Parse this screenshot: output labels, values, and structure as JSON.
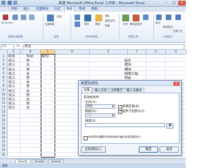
{
  "window": {
    "title": "新建 Microsoft Office Excel 工作表 - Microsoft Excel",
    "min": "–",
    "max": "□",
    "close": "×"
  },
  "ribbon_tabs": [
    "开始",
    "插入",
    "页面布局",
    "公式",
    "数据",
    "审阅",
    "视图"
  ],
  "ribbon_active_tab": "数据",
  "ribbon_groups": {
    "get_external": "获取外部数据",
    "connections": "连接",
    "sort_filter": "排序和筛选",
    "data_tools": "数据工具",
    "outline": "分级显示",
    "access": "自 Access",
    "refresh": "全部刷新",
    "sort": "排序",
    "filter": "筛选",
    "clear": "清除",
    "reapply": "重新应用",
    "advanced": "高级",
    "text_to_columns": "分列",
    "remove_dup": "删除重复项",
    "group": "组合",
    "ungroup": "取消组合",
    "subtotal": "分类汇总"
  },
  "formula_bar": {
    "name_box": "C1",
    "fx": "fx",
    "value": "职业"
  },
  "columns": [
    "A",
    "B",
    "C",
    "D",
    "E",
    "F",
    "G",
    "H"
  ],
  "rows": [
    "1",
    "2",
    "3",
    "4",
    "5",
    "6",
    "7",
    "8",
    "9",
    "10",
    "11",
    "12",
    "13",
    "14",
    "15",
    "16",
    "17",
    "18",
    "19",
    "20",
    "21",
    "22",
    "23",
    "24"
  ],
  "cells": {
    "header": [
      "姓名",
      "性别",
      "职业"
    ],
    "names": [
      "张三",
      "张三",
      "张三",
      "张三",
      "张三",
      "张三",
      "张三",
      "张三",
      "张三",
      "张三",
      "张三",
      "张三"
    ],
    "genders": [
      "男",
      "女",
      "男",
      "女",
      "男",
      "女",
      "男",
      "女",
      "男",
      "女",
      "男",
      "女"
    ],
    "occupations": [
      "医生",
      "老师",
      "律师",
      "网络工程",
      "农民",
      "编辑工作",
      "工人"
    ]
  },
  "sheet_tabs": [
    "Sheet1",
    "Sheet2",
    "Sheet3"
  ],
  "status": "就绪",
  "dialog": {
    "title": "数据有效性",
    "close": "×",
    "tabs": [
      "设置",
      "输入信息",
      "出错警告",
      "输入法模式"
    ],
    "active_tab": "设置",
    "criteria_label": "有效性条件",
    "allow_label": "允许(A):",
    "allow_value": "序列",
    "data_label": "数据(D):",
    "data_value": "介于",
    "ignore_blank": "忽略空值(B)",
    "dropdown": "提供下拉箭头(I)",
    "source_label": "来源(S):",
    "source_value": "",
    "apply_all": "对有同样设置的所有其他单元格应用这些更改(P)",
    "clear_all": "全部清除(C)",
    "ok": "确定",
    "cancel": "取消"
  },
  "colors": {
    "ribbon_text": "#15428b",
    "dialog_border": "#6f8fb8",
    "close_red": "#d9574a"
  }
}
